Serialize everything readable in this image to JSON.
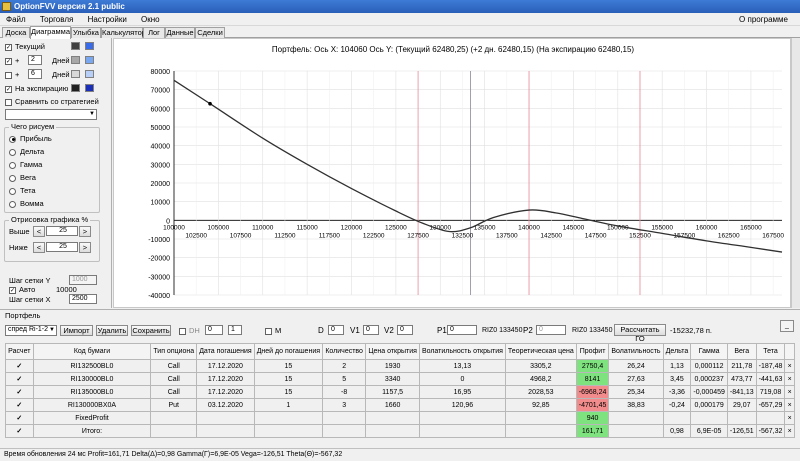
{
  "app": {
    "title": "OptionFVV версия 2.1 public"
  },
  "menu": {
    "items": [
      "Файл",
      "Торговля",
      "Настройки",
      "Окно"
    ],
    "about": "О программе"
  },
  "tabs": [
    "Доска",
    "Диаграмма",
    "Улыбка",
    "Калькулятор",
    "Лог",
    "Данные",
    "Сделки"
  ],
  "left": {
    "current": {
      "label": "Текущий",
      "checked": "✓"
    },
    "plus1": {
      "sign": "+",
      "days": "2",
      "label": "Дней",
      "checked": "✓"
    },
    "plus2": {
      "sign": "+",
      "days": "6",
      "label": "Дней",
      "checked": ""
    },
    "expiry": {
      "label": "На экспирацию",
      "checked": "✓"
    },
    "compare": {
      "label": "Сравнить со стратегией",
      "checked": ""
    },
    "draw_group": "Чего рисуем",
    "draw_options": [
      "Прибыль",
      "Дельта",
      "Гамма",
      "Вега",
      "Тета",
      "Вомма"
    ],
    "render_group": "Отрисовка графика %",
    "above_label": "Выше",
    "above_value": "25",
    "below_label": "Ниже",
    "below_value": "25",
    "step_y_label": "Шаг сетки Y",
    "step_y_value": "1000",
    "auto_label": "Авто",
    "auto_value": "10000",
    "step_x_label": "Шаг сетки X",
    "step_x_value": "2500",
    "colors": {
      "current": [
        "#404040",
        "#3a6be8"
      ],
      "plus1": [
        "#a8a8a8",
        "#7aa8f0"
      ],
      "plus2": [
        "#d8d8d8",
        "#b8d0f8"
      ],
      "expiry": [
        "#202020",
        "#1a2fb8"
      ]
    }
  },
  "chart_data": {
    "type": "line",
    "title": "Портфель: Ось X: 104060 Ось Y:  (Текущий 62480,25)  (+2 дн. 62480,15)  (На экспирацию 62480,15)",
    "xlim": [
      100000,
      168500
    ],
    "ylim": [
      -40000,
      80000
    ],
    "x_ticks_top": [
      "100000",
      "105000",
      "110000",
      "115000",
      "120000",
      "125000",
      "130000",
      "135000",
      "140000",
      "145000",
      "150000",
      "155000",
      "160000",
      "165000"
    ],
    "x_ticks_bottom": [
      "102500",
      "107500",
      "112500",
      "117500",
      "122500",
      "127500",
      "132500",
      "137500",
      "142500",
      "147500",
      "152500",
      "157500",
      "162500",
      "167500"
    ],
    "y_ticks": [
      "80000",
      "70000",
      "60000",
      "50000",
      "40000",
      "30000",
      "20000",
      "10000",
      "0",
      "-10000",
      "-20000",
      "-30000",
      "-40000"
    ],
    "vlines_red": [
      127500,
      140000,
      152500
    ],
    "vline_current": 133400,
    "marker": {
      "x": 104060,
      "y": 62480
    },
    "series": [
      {
        "x": [
          100000,
          104060,
          110000,
          115000,
          120000,
          125000,
          128000,
          131000,
          133400,
          136000,
          140000,
          143000,
          146000,
          150000,
          155000,
          160000,
          165000,
          168500
        ],
        "y": [
          75000,
          62480,
          44000,
          30000,
          17000,
          5000,
          -1500,
          -6000,
          -4000,
          1500,
          5500,
          4000,
          1000,
          -3000,
          -7000,
          -11000,
          -14500,
          -17000
        ]
      }
    ]
  },
  "portfolio": {
    "title": "Портфель",
    "spread": "спред Ri-1-2",
    "import_btn": "Импорт",
    "delete_btn": "Удалить",
    "save_btn": "Сохранить",
    "dh_label": "DH",
    "dh_value": "0",
    "dh2": "1",
    "m_label": "M",
    "d_label": "D",
    "d_value": "0",
    "v1_label": "V1",
    "v1_value": "0",
    "v2_label": "V2",
    "v2_value": "0",
    "p1_label": "P1",
    "p1_value": "0",
    "ri1": "RIZ0 133450",
    "p2_label": "P2",
    "p2_value": "0",
    "ri2": "RIZ0 133450",
    "go_btn": "Рассчитать ГО",
    "go_value": "-15232,78 п."
  },
  "table": {
    "headers": [
      "Расчет",
      "Код бумаги",
      "Тип опциона",
      "Дата погашения",
      "Дней до погашения",
      "Количество",
      "Цена открытия",
      "Волатильность открытия",
      "Теоретическая цена",
      "Профит",
      "Волатильность",
      "Дельта",
      "Гамма",
      "Вега",
      "Тета",
      ""
    ],
    "rows": [
      [
        "✓",
        "RI132500BL0",
        "Call",
        "17.12.2020",
        "15",
        "2",
        "1930",
        "13,13",
        "3305,2",
        "2750,4",
        "26,24",
        "1,13",
        "0,000112",
        "211,78",
        "-187,48",
        "×"
      ],
      [
        "✓",
        "RI130000BL0",
        "Call",
        "17.12.2020",
        "15",
        "5",
        "3340",
        "0",
        "4968,2",
        "8141",
        "27,63",
        "3,45",
        "0,000237",
        "473,77",
        "-441,63",
        "×"
      ],
      [
        "✓",
        "RI135000BL0",
        "Call",
        "17.12.2020",
        "15",
        "-8",
        "1157,5",
        "16,95",
        "2028,53",
        "-6968,24",
        "25,34",
        "-3,36",
        "-0,000459",
        "-841,13",
        "719,08",
        "×"
      ],
      [
        "✓",
        "RI130000BX0A",
        "Put",
        "03.12.2020",
        "1",
        "3",
        "1660",
        "120,96",
        "92,85",
        "-4701,45",
        "38,83",
        "-0,24",
        "0,000179",
        "29,07",
        "-657,29",
        "×"
      ],
      [
        "✓",
        "FixedProfit",
        "",
        "",
        "",
        "",
        "",
        "",
        "",
        "940",
        "",
        "",
        "",
        "",
        "",
        "×"
      ],
      [
        "✓",
        "Итого:",
        "",
        "",
        "",
        "",
        "",
        "",
        "",
        "161,71",
        "",
        "0,98",
        "6,9E-05",
        "-126,51",
        "-567,32",
        "×"
      ]
    ],
    "profit_colors": [
      "green",
      "green",
      "red",
      "red",
      "green",
      "green"
    ]
  },
  "status": "Время обновления 24 мс  Profit=161,71 Delta(Δ)=0,98 Gamma(Γ)=6,9E-05 Vega=-126,51 Theta(Θ)=-567,32"
}
